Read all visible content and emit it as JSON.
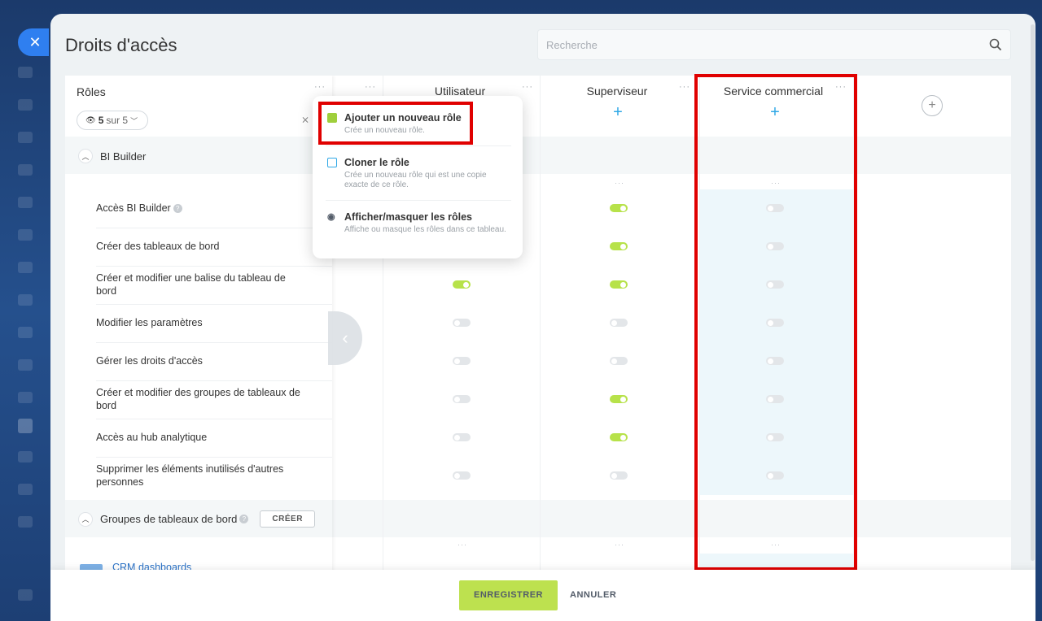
{
  "header": {
    "title": "Droits d'accès",
    "search_placeholder": "Recherche"
  },
  "roles": {
    "title": "Rôles",
    "filter_count": "5",
    "filter_suffix": "sur 5"
  },
  "columns": [
    {
      "name": "Utilisateur"
    },
    {
      "name": "Superviseur"
    },
    {
      "name": "Service commercial"
    }
  ],
  "sections": {
    "bi": {
      "label": "BI Builder"
    },
    "groups": {
      "label": "Groupes de tableaux de bord",
      "create_label": "CRÉER"
    }
  },
  "rows": [
    {
      "label": "Accès BI Builder",
      "values": [
        null,
        true,
        false
      ]
    },
    {
      "label": "Créer des tableaux de bord",
      "values": [
        null,
        true,
        false
      ]
    },
    {
      "label": "Créer et modifier une balise du tableau de bord",
      "values": [
        true,
        true,
        false
      ]
    },
    {
      "label": "Modifier les paramètres",
      "values": [
        false,
        false,
        false
      ]
    },
    {
      "label": "Gérer les droits d'accès",
      "values": [
        false,
        false,
        false
      ]
    },
    {
      "label": "Créer et modifier des groupes de tableaux de bord",
      "values": [
        false,
        true,
        false
      ]
    },
    {
      "label": "Accès au hub analytique",
      "values": [
        false,
        true,
        false
      ]
    },
    {
      "label": "Supprimer les éléments inutilisés d'autres personnes",
      "values": [
        false,
        false,
        false
      ]
    }
  ],
  "crm_link": "CRM dashboards",
  "menu": {
    "items": [
      {
        "title": "Ajouter un nouveau rôle",
        "desc": "Crée un nouveau rôle."
      },
      {
        "title": "Cloner le rôle",
        "desc": "Crée un nouveau rôle qui est une copie exacte de ce rôle."
      },
      {
        "title": "Afficher/masquer les rôles",
        "desc": "Affiche ou masque les rôles dans ce tableau."
      }
    ]
  },
  "footer": {
    "save_label": "ENREGISTRER",
    "cancel_label": "ANNULER"
  },
  "colors": {
    "accent": "#bde14f",
    "toggle_on": "#b7e24a",
    "highlight": "#e00000",
    "link": "#2a72c7",
    "plus": "#2fa8e6"
  }
}
